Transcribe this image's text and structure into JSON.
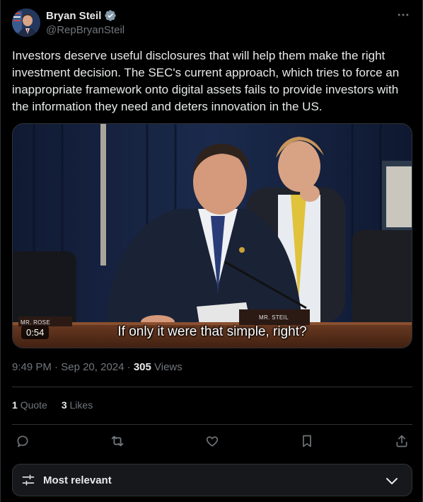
{
  "author": {
    "name": "Bryan Steil",
    "handle": "@RepBryanSteil",
    "verified_icon": "verified-badge-icon"
  },
  "tweet": {
    "text": "Investors deserve useful disclosures that will help them make the right investment decision. The SEC's current approach, which tries to force an inappropriate framework onto digital assets fails to provide investors with the information they need and deters innovation in the US."
  },
  "media": {
    "duration": "0:54",
    "caption": "If only it were that simple, right?",
    "nameplate_left": "MR. ROSE",
    "nameplate_right": "MR. STEIL"
  },
  "meta": {
    "time": "9:49 PM",
    "date": "Sep 20, 2024",
    "views_count": "305",
    "views_label": "Views"
  },
  "stats": {
    "quotes_count": "1",
    "quotes_label": "Quote",
    "likes_count": "3",
    "likes_label": "Likes"
  },
  "actions": [
    "reply-icon",
    "repost-icon",
    "like-icon",
    "bookmark-icon",
    "share-icon"
  ],
  "sort": {
    "label": "Most relevant"
  },
  "colors": {
    "background": "#000000",
    "text": "#e7e9ea",
    "secondary": "#71767b",
    "border": "#2f3336",
    "verified": "#829aab"
  }
}
